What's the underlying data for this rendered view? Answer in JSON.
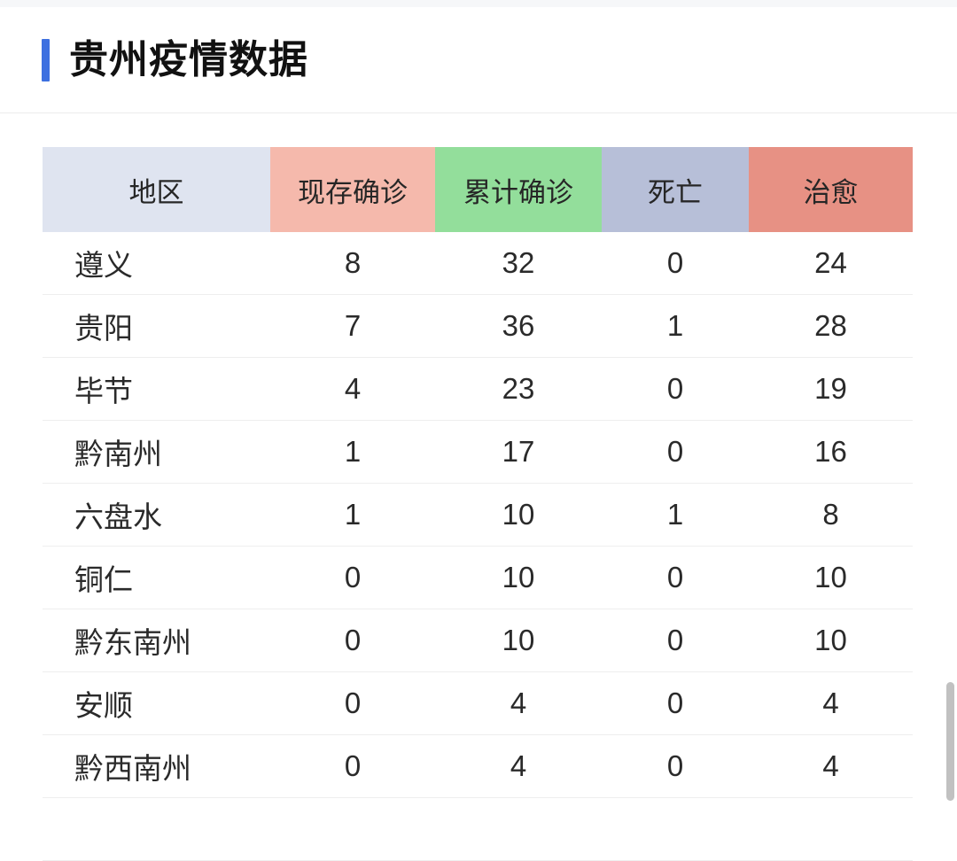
{
  "header": {
    "title": "贵州疫情数据",
    "accent_color": "#3d70e0"
  },
  "table": {
    "columns": [
      {
        "label": "地区",
        "key": "region",
        "bg": "#dfe4f0"
      },
      {
        "label": "现存确诊",
        "key": "current",
        "bg": "#f5b9ac"
      },
      {
        "label": "累计确诊",
        "key": "total",
        "bg": "#93de9b"
      },
      {
        "label": "死亡",
        "key": "death",
        "bg": "#b7bfd8"
      },
      {
        "label": "治愈",
        "key": "cured",
        "bg": "#e79184"
      }
    ],
    "rows": [
      {
        "region": "遵义",
        "current": "8",
        "total": "32",
        "death": "0",
        "cured": "24"
      },
      {
        "region": "贵阳",
        "current": "7",
        "total": "36",
        "death": "1",
        "cured": "28"
      },
      {
        "region": "毕节",
        "current": "4",
        "total": "23",
        "death": "0",
        "cured": "19"
      },
      {
        "region": "黔南州",
        "current": "1",
        "total": "17",
        "death": "0",
        "cured": "16"
      },
      {
        "region": "六盘水",
        "current": "1",
        "total": "10",
        "death": "1",
        "cured": "8"
      },
      {
        "region": "铜仁",
        "current": "0",
        "total": "10",
        "death": "0",
        "cured": "10"
      },
      {
        "region": "黔东南州",
        "current": "0",
        "total": "10",
        "death": "0",
        "cured": "10"
      },
      {
        "region": "安顺",
        "current": "0",
        "total": "4",
        "death": "0",
        "cured": "4"
      },
      {
        "region": "黔西南州",
        "current": "0",
        "total": "4",
        "death": "0",
        "cured": "4"
      }
    ]
  },
  "scrollbar": {
    "thumb_color": "#c1c1c1"
  },
  "chart_data": {
    "type": "table",
    "title": "贵州疫情数据",
    "categories": [
      "遵义",
      "贵阳",
      "毕节",
      "黔南州",
      "六盘水",
      "铜仁",
      "黔东南州",
      "安顺",
      "黔西南州"
    ],
    "series": [
      {
        "name": "现存确诊",
        "values": [
          8,
          7,
          4,
          1,
          1,
          0,
          0,
          0,
          0
        ]
      },
      {
        "name": "累计确诊",
        "values": [
          32,
          36,
          23,
          17,
          10,
          10,
          10,
          4,
          4
        ]
      },
      {
        "name": "死亡",
        "values": [
          0,
          1,
          0,
          0,
          1,
          0,
          0,
          0,
          0
        ]
      },
      {
        "name": "治愈",
        "values": [
          24,
          28,
          19,
          16,
          8,
          10,
          10,
          4,
          4
        ]
      }
    ],
    "xlabel": "地区",
    "ylabel": "",
    "legend": [
      "现存确诊",
      "累计确诊",
      "死亡",
      "治愈"
    ]
  }
}
